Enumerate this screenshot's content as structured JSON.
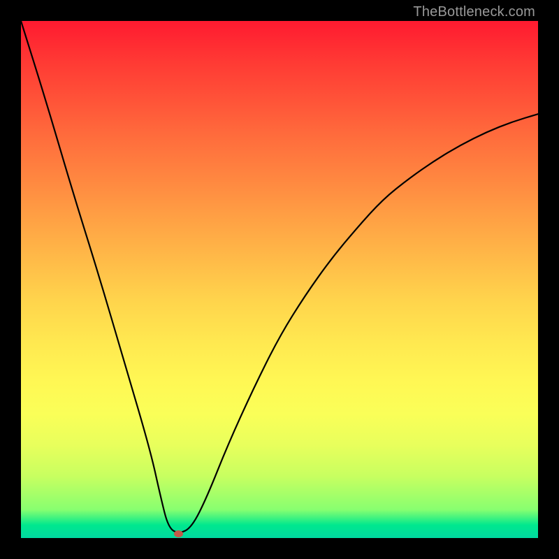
{
  "watermark": "TheBottleneck.com",
  "chart_data": {
    "type": "line",
    "title": "",
    "xlabel": "",
    "ylabel": "",
    "xlim": [
      0,
      100
    ],
    "ylim": [
      0,
      100
    ],
    "series": [
      {
        "name": "curve",
        "x": [
          0,
          5,
          10,
          15,
          20,
          25,
          27,
          28.5,
          30.5,
          33,
          36,
          40,
          45,
          50,
          55,
          60,
          65,
          70,
          75,
          80,
          85,
          90,
          95,
          100
        ],
        "values": [
          100,
          84,
          67,
          51,
          34,
          17,
          8,
          2,
          0.8,
          2,
          8,
          18,
          29,
          39,
          47,
          54,
          60,
          65.5,
          69.5,
          73,
          76,
          78.5,
          80.5,
          82
        ]
      }
    ],
    "marker": {
      "x": 30.5,
      "y": 0.8,
      "color": "#c35a4a"
    },
    "gradient_stops": [
      {
        "pos": 0,
        "color": "#ff1a30"
      },
      {
        "pos": 0.5,
        "color": "#ffd44c"
      },
      {
        "pos": 0.95,
        "color": "#88ff70"
      },
      {
        "pos": 1.0,
        "color": "#00d8a0"
      }
    ]
  }
}
